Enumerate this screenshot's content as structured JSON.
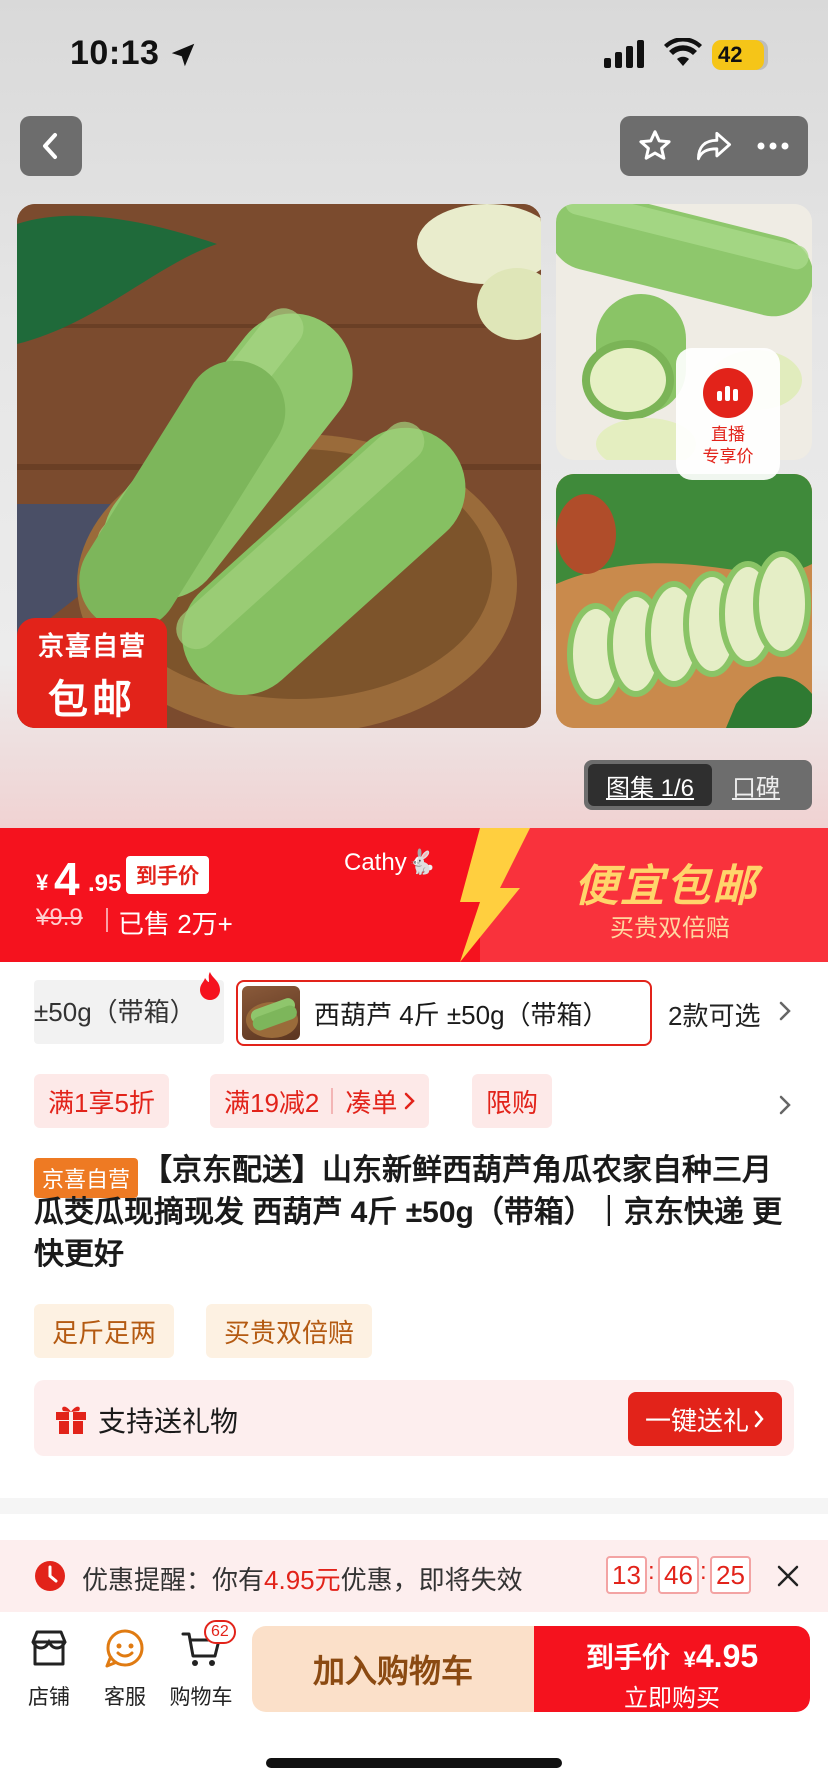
{
  "status_bar": {
    "time": "10:13",
    "battery": "42"
  },
  "gallery": {
    "badge_line1": "京喜自营",
    "badge_line2": "包邮",
    "live_line1": "直播",
    "live_line2": "专享价",
    "tab_active": "图集 1/6",
    "tab_other": "口碑"
  },
  "price": {
    "currency": "¥",
    "integer": "4",
    "decimal": ".95",
    "tag": "到手价",
    "original": "¥9.9",
    "sold": "已售 2万+",
    "user": "Cathy🐇",
    "promo_title": "便宜包邮",
    "promo_sub": "买贵双倍赔"
  },
  "sku": {
    "prev_option": "±50g（带箱）",
    "selected_option": "西葫芦 4斤 ±50g（带箱）",
    "more": "2款可选"
  },
  "coupons": [
    "满1享5折",
    "满19减2",
    "凑单",
    "限购"
  ],
  "product": {
    "self_tag": "京喜自营",
    "title": "【京东配送】山东新鲜西葫芦角瓜农家自种三月瓜茭瓜现摘现发 西葫芦 4斤 ±50g（带箱）｜京东快递 更快更好",
    "features": [
      "足斤足两",
      "买贵双倍赔"
    ]
  },
  "gift": {
    "label": "支持送礼物",
    "button": "一键送礼"
  },
  "reminder": {
    "prefix": "优惠提醒：你有",
    "amount": "4.95元",
    "suffix": "优惠，即将失效",
    "hours": "13",
    "minutes": "46",
    "seconds": "25"
  },
  "bottom_bar": {
    "store": "店铺",
    "service": "客服",
    "cart": "购物车",
    "cart_count": "62",
    "add_to_cart": "加入购物车",
    "buy_line1": "到手价",
    "buy_currency": "¥",
    "buy_price": "4.95",
    "buy_line2": "立即购买"
  },
  "colors": {
    "accent": "#f5121e",
    "orange": "#ee7a23",
    "gold": "#ffd56b"
  }
}
